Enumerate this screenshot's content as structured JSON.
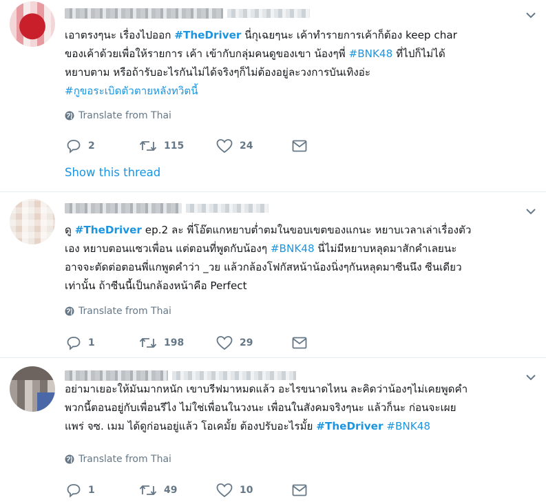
{
  "tweets": [
    {
      "lines": [
        [
          {
            "t": "เอาตรงๆนะ เรื่องไปออก "
          },
          {
            "t": "#TheDriver",
            "tag": "bold"
          },
          {
            "t": "  นี่กุเฉยๆนะ เค้าทำรายการเค้าก็ต้อง keep char"
          }
        ],
        [
          {
            "t": "ของเค้าด้วยเพื่อให้รายการ เค้า เข้ากับกลุ่มคนดูของเขา น้องๆพี่ "
          },
          {
            "t": "#BNK48",
            "tag": "plain"
          },
          {
            "t": " ที่ไปก็ไม่ได้"
          }
        ],
        [
          {
            "t": "หยาบตาม หรือถ้ารับอะไรกันไม่ได้จริงๆก็ไม่ต้องอยู่ละวงการบันเทิงอ่ะ"
          }
        ],
        [
          {
            "t": "#กูขอระเบิดตัวตายหลังทวิตนี้",
            "tag": "plain"
          }
        ]
      ],
      "translate": "Translate from Thai",
      "replies": "2",
      "retweets": "115",
      "likes": "24",
      "thread": "Show this thread"
    },
    {
      "lines": [
        [
          {
            "t": "ดู "
          },
          {
            "t": "#TheDriver",
            "tag": "bold"
          },
          {
            "t": " ep.2 ละ พี่โอ๊ตแกหยาบต่ำตมในขอบเขตของแกนะ หยาบเวลาเล่าเรื่องตัว"
          }
        ],
        [
          {
            "t": "เอง หยาบตอนแซวเพื่อน แต่ตอนที่พูดกับน้องๆ "
          },
          {
            "t": "#BNK48",
            "tag": "plain"
          },
          {
            "t": " นี่ไม่มีหยาบหลุดมาสักคำเลยนะ"
          }
        ],
        [
          {
            "t": "อาจจะตัดต่อตอนพี่แกพูดคำว่า _วย แล้วกล้องโฟกัสหน้าน้องนิ่งๆกันหลุดมาซีนนึง ซีนเดียว"
          }
        ],
        [
          {
            "t": "เท่านั้น ถ้าซีนนี้เป็นกล้องหน้าคือ Perfect"
          }
        ]
      ],
      "translate": "Translate from Thai",
      "replies": "1",
      "retweets": "198",
      "likes": "29"
    },
    {
      "lines": [
        [
          {
            "t": "อย่ามาเยอะให้มันมากหนัก เขาบรีฟมาหมดแล้ว อะไรขนาดไหน ละคิดว่าน้องๆไม่เคยพูดคำ"
          }
        ],
        [
          {
            "t": "พวกนี้ตอนอยู่กับเพื่อนรึไง ไม่ใช่เพื่อนในวงนะ เพื่อนในสังคมจริงๆนะ แล้วก็นะ ก่อนจะเผย"
          }
        ],
        [
          {
            "t": "แพร่ จซ. เมม ได้ดูก่อนอยู่แล้ว โอเคมั้ย ต้องปรับอะไรมั้ย "
          },
          {
            "t": "#TheDriver",
            "tag": "bold"
          },
          {
            "t": " "
          },
          {
            "t": "#BNK48",
            "tag": "plain"
          }
        ]
      ],
      "translate": "Translate from Thai",
      "replies": "1",
      "retweets": "49",
      "likes": "10"
    }
  ],
  "icons": {
    "reply": "reply-icon",
    "retweet": "retweet-icon",
    "like": "heart-icon",
    "dm": "envelope-icon",
    "globe": "globe-icon",
    "more": "chevron-down-icon"
  },
  "colors": {
    "link": "#1b95e0",
    "muted": "#657786",
    "text": "#14171a",
    "divider": "#e6ecf0"
  }
}
